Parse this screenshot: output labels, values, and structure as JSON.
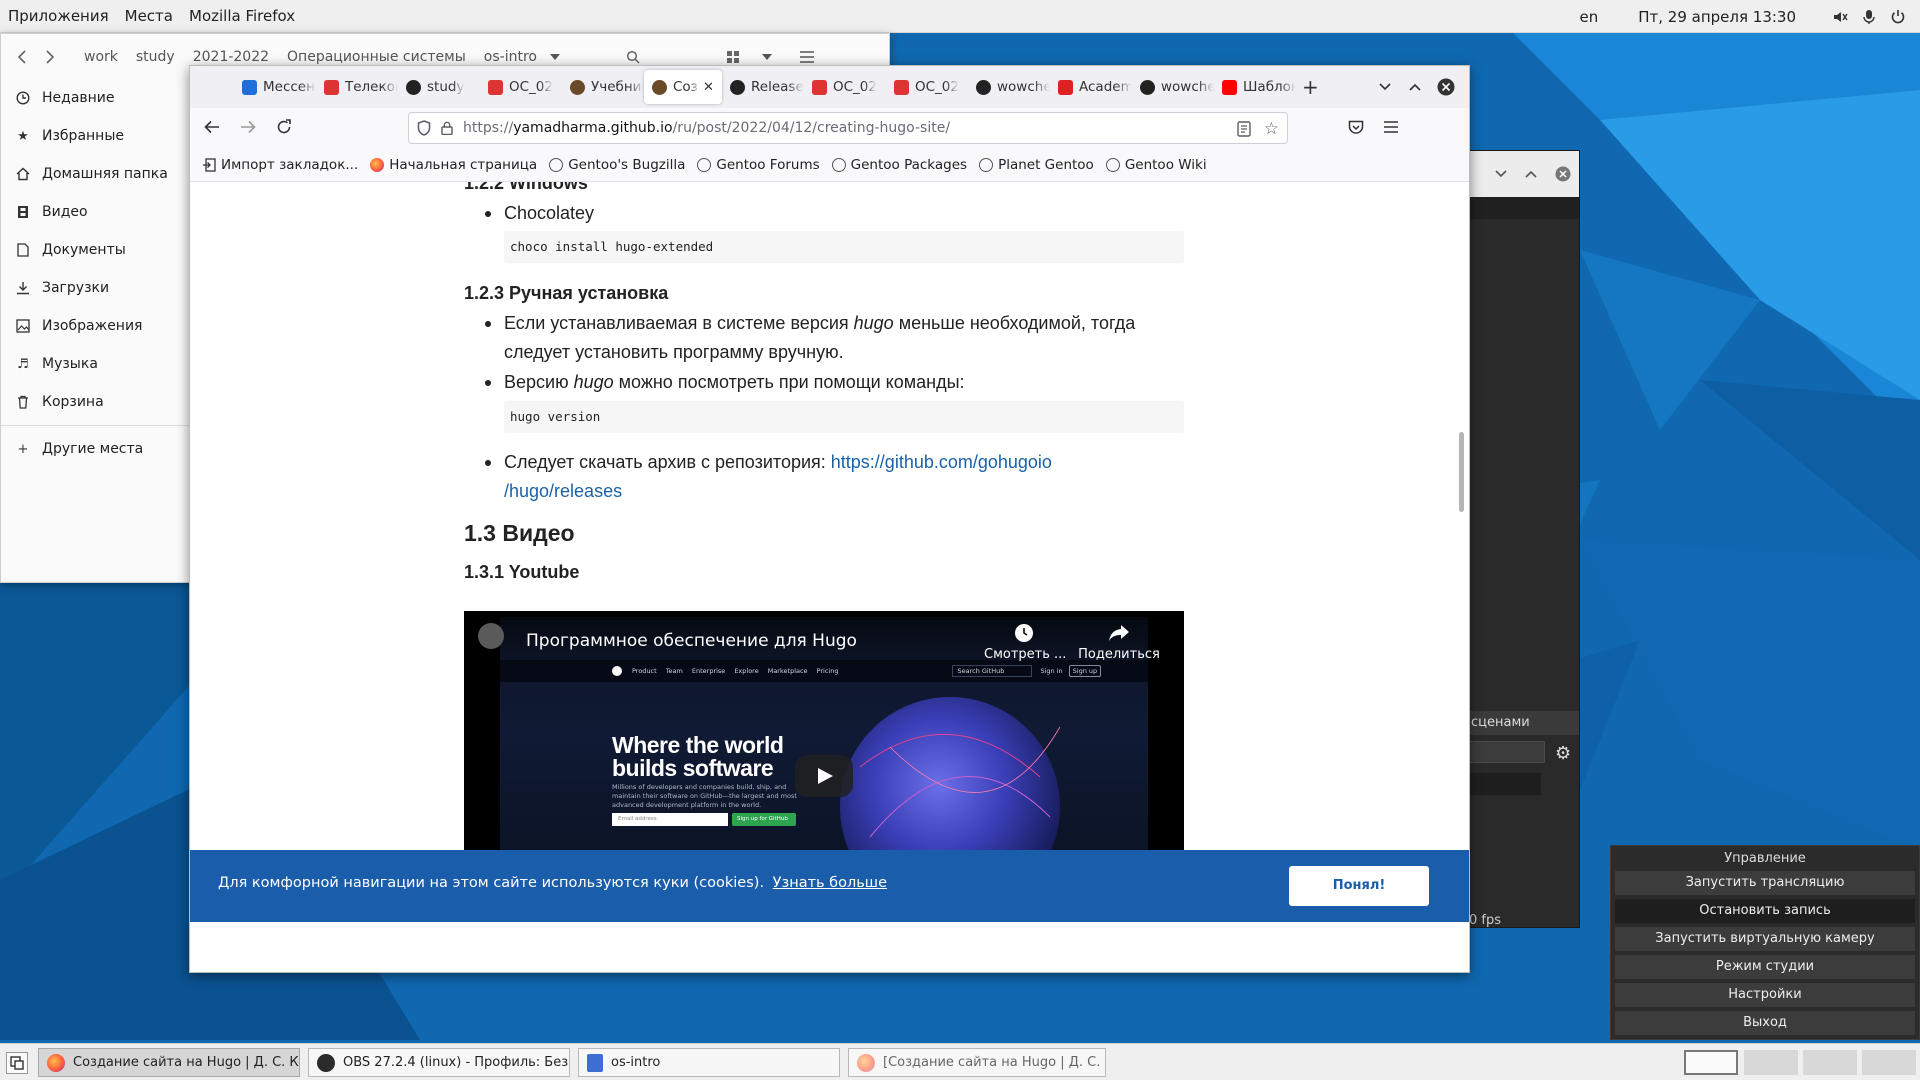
{
  "top_panel": {
    "apps_menu": "Приложения",
    "places_menu": "Места",
    "active_app": "Mozilla Firefox",
    "keyboard_layout": "en",
    "datetime": "Пт, 29 апреля  13:30"
  },
  "file_manager": {
    "breadcrumbs": [
      "work",
      "study",
      "2021-2022",
      "Операционные системы",
      "os-intro"
    ],
    "sidebar": [
      {
        "label": "Недавние",
        "icon": "clock-icon"
      },
      {
        "label": "Избранные",
        "icon": "star-icon"
      },
      {
        "label": "Домашняя папка",
        "icon": "home-icon"
      },
      {
        "label": "Видео",
        "icon": "film-icon"
      },
      {
        "label": "Документы",
        "icon": "document-icon"
      },
      {
        "label": "Загрузки",
        "icon": "download-icon"
      },
      {
        "label": "Изображения",
        "icon": "image-icon"
      },
      {
        "label": "Музыка",
        "icon": "music-icon"
      },
      {
        "label": "Корзина",
        "icon": "trash-icon"
      }
    ],
    "other_places": "Другие места"
  },
  "firefox": {
    "tabs": [
      {
        "label": "Мессенджер",
        "icon_color": "#1e6fd9"
      },
      {
        "label": "Телеконференции",
        "icon_color": "#d33"
      },
      {
        "label": "study",
        "icon_color": "#222"
      },
      {
        "label": "ОС_02",
        "icon_color": "#d33"
      },
      {
        "label": "Учебник",
        "icon_color": "#6b4a2a"
      },
      {
        "label": "Создание сайта",
        "icon_color": "#6b4a2a",
        "active": true
      },
      {
        "label": "Releases",
        "icon_color": "#222"
      },
      {
        "label": "ОС_02",
        "icon_color": "#d33"
      },
      {
        "label": "ОС_02",
        "icon_color": "#d33"
      },
      {
        "label": "wowchemy",
        "icon_color": "#222"
      },
      {
        "label": "Academic",
        "icon_color": "#d22"
      },
      {
        "label": "wowchemy",
        "icon_color": "#222"
      },
      {
        "label": "Шаблоны",
        "icon_color": "#f00"
      }
    ],
    "url_prefix": "https://",
    "url_host": "yamadharma.github.io",
    "url_path": "/ru/post/2022/04/12/creating-hugo-site/",
    "bookmarks": [
      {
        "label": "Импорт закладок...",
        "icon": "import-icon"
      },
      {
        "label": "Начальная страница",
        "icon": "firefox-icon"
      },
      {
        "label": "Gentoo's Bugzilla",
        "icon": "globe-icon"
      },
      {
        "label": "Gentoo Forums",
        "icon": "globe-icon"
      },
      {
        "label": "Gentoo Packages",
        "icon": "globe-icon"
      },
      {
        "label": "Planet Gentoo",
        "icon": "globe-icon"
      },
      {
        "label": "Gentoo Wiki",
        "icon": "globe-icon"
      }
    ]
  },
  "page": {
    "heading_windows": "1.2.2 Windows",
    "choco_item": "Chocolatey",
    "choco_code": "choco install hugo-extended",
    "heading_manual": "1.2.3 Ручная установка",
    "manual_text_1a": "Если устанавливаемая в системе версия ",
    "manual_text_1b": "hugo",
    "manual_text_1c": " меньше необходимой, тогда",
    "manual_text_2": "следует установить программу вручную.",
    "version_text_a": "Версию ",
    "version_text_b": "hugo",
    "version_text_c": " можно посмотреть при помощи команды:",
    "version_code": "hugo version",
    "archive_text": "Следует скачать архив с репозитория: ",
    "archive_link_1": "https://github.com/gohugoio",
    "archive_link_2": "/hugo/releases",
    "heading_video": "1.3 Видео",
    "heading_youtube": "1.3.1 Youtube",
    "video": {
      "title": "Программное обеспечение для Hugo",
      "watch_later": "Смотреть ...",
      "share": "Поделиться",
      "hero_line1": "Where the world",
      "hero_line2": "builds software",
      "hero_sub": "Millions of developers and companies build, ship, and maintain their software on GitHub—the largest and most advanced development platform in the world.",
      "email_placeholder": "Email address",
      "signup_button": "Sign up for GitHub",
      "nav_items": [
        "Product",
        "Team",
        "Enterprise",
        "Explore",
        "Marketplace",
        "Pricing"
      ],
      "search_placeholder": "Search GitHub",
      "sign_in": "Sign in",
      "sign_up": "Sign up"
    },
    "cookie_text": "Для комфорной навигации на этом сайте используются куки (cookies).",
    "cookie_link": "Узнать больше",
    "cookie_button": "Понял!"
  },
  "obs": {
    "scenes_label": "сценами",
    "fps_label": "0 fps",
    "controls_title": "Управление",
    "buttons": [
      {
        "label": "Запустить трансляцию"
      },
      {
        "label": "Остановить запись",
        "active": true
      },
      {
        "label": "Запустить виртуальную камеру"
      },
      {
        "label": "Режим студии"
      },
      {
        "label": "Настройки"
      },
      {
        "label": "Выход"
      }
    ]
  },
  "taskbar": {
    "items": [
      {
        "label": "Создание сайта на Hugo | Д. С. К...",
        "icon": "firefox-icon",
        "active": true
      },
      {
        "label": "OBS 27.2.4 (linux) - Профиль: Без...",
        "icon": "obs-icon"
      },
      {
        "label": "os-intro",
        "icon": "files-icon"
      },
      {
        "label": "[Создание сайта на Hugo | Д. С. ...",
        "icon": "firefox-icon"
      }
    ]
  },
  "colors": {
    "desktop_bg": "#0f68b0",
    "link": "#1a62a8",
    "cookie_bar": "#1a5dab",
    "github_green": "#2ea44f"
  }
}
